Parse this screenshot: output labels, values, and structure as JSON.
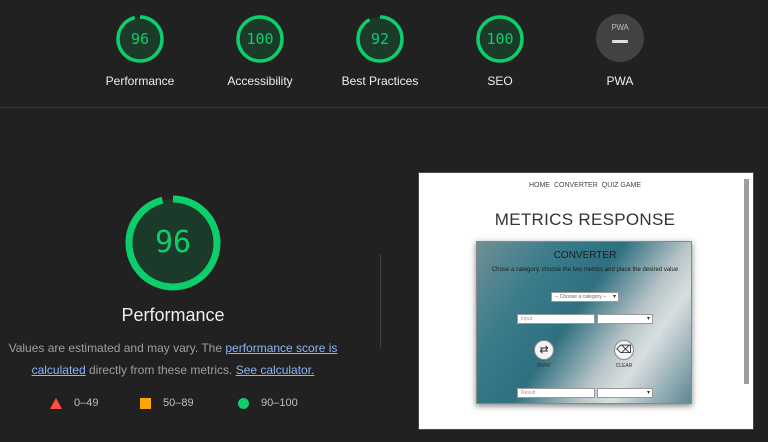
{
  "colors": {
    "pass": "#0cce6b",
    "average": "#ffa400",
    "fail": "#ff4e42",
    "background": "#212121"
  },
  "summary": [
    {
      "label": "Performance",
      "score": "96",
      "value": 96
    },
    {
      "label": "Accessibility",
      "score": "100",
      "value": 100
    },
    {
      "label": "Best Practices",
      "score": "92",
      "value": 92
    },
    {
      "label": "SEO",
      "score": "100",
      "value": 100
    }
  ],
  "pwa": {
    "label": "PWA",
    "badge_text": "PWA"
  },
  "performance": {
    "score": "96",
    "value": 96,
    "title": "Performance",
    "desc_prefix": "Values are estimated and may vary. The ",
    "desc_link1": "performance score is calculated",
    "desc_middle": " directly from these metrics. ",
    "desc_link2": "See calculator."
  },
  "legend": {
    "fail": "0–49",
    "average": "50–89",
    "pass": "90–100"
  },
  "screenshot": {
    "nav": [
      "HOME",
      "CONVERTER",
      "QUIZ GAME"
    ],
    "heading": "METRICS RESPONSE",
    "card_title": "CONVERTER",
    "card_desc": "Chose a category, choose the two metrics and place the desired value",
    "category_select": "-- Choose a category --",
    "input_placeholder": "Input",
    "result_placeholder": "Result",
    "swap_label": "SWAP",
    "clear_label": "CLEAR",
    "swap_icon": "swap-icon",
    "clear_icon": "eraser-icon"
  }
}
